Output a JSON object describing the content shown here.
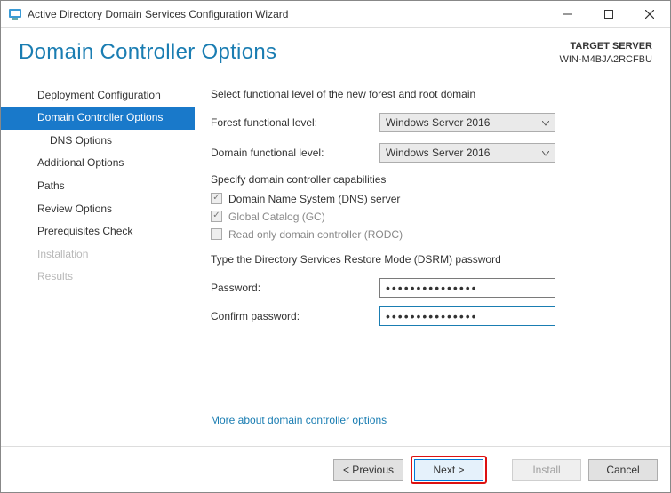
{
  "titlebar": {
    "title": "Active Directory Domain Services Configuration Wizard"
  },
  "header": {
    "title": "Domain Controller Options",
    "target_label": "TARGET SERVER",
    "target_name": "WIN-M4BJA2RCFBU"
  },
  "sidebar": {
    "items": [
      {
        "label": "Deployment Configuration",
        "level": 1,
        "state": ""
      },
      {
        "label": "Domain Controller Options",
        "level": 1,
        "state": "selected"
      },
      {
        "label": "DNS Options",
        "level": 2,
        "state": ""
      },
      {
        "label": "Additional Options",
        "level": 1,
        "state": ""
      },
      {
        "label": "Paths",
        "level": 1,
        "state": ""
      },
      {
        "label": "Review Options",
        "level": 1,
        "state": ""
      },
      {
        "label": "Prerequisites Check",
        "level": 1,
        "state": ""
      },
      {
        "label": "Installation",
        "level": 1,
        "state": "disabled"
      },
      {
        "label": "Results",
        "level": 1,
        "state": "disabled"
      }
    ]
  },
  "content": {
    "intro": "Select functional level of the new forest and root domain",
    "forest_label": "Forest functional level:",
    "forest_value": "Windows Server 2016",
    "domain_label": "Domain functional level:",
    "domain_value": "Windows Server 2016",
    "capabilities_label": "Specify domain controller capabilities",
    "chk_dns": "Domain Name System (DNS) server",
    "chk_gc": "Global Catalog (GC)",
    "chk_rodc": "Read only domain controller (RODC)",
    "dsrm_intro": "Type the Directory Services Restore Mode (DSRM) password",
    "pwd_label": "Password:",
    "pwd_confirm_label": "Confirm password:",
    "pwd_mask": "•••••••••••••••",
    "link": "More about domain controller options"
  },
  "footer": {
    "prev": "< Previous",
    "next": "Next >",
    "install": "Install",
    "cancel": "Cancel"
  }
}
